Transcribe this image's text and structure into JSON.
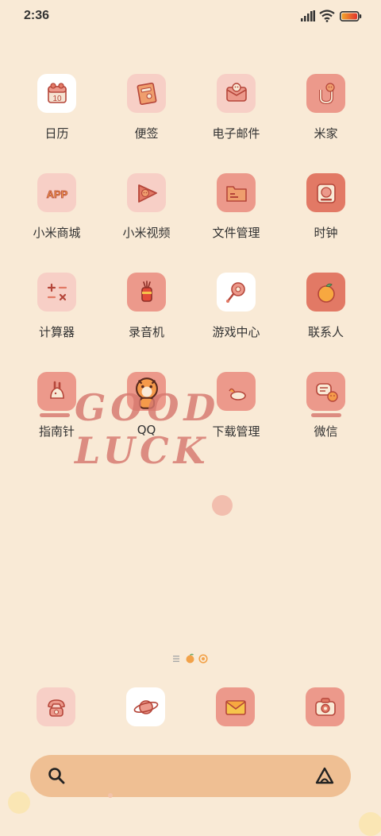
{
  "status_bar": {
    "time": "2:36"
  },
  "apps": [
    {
      "label": "日历",
      "icon": "calendar-icon"
    },
    {
      "label": "便签",
      "icon": "notes-icon"
    },
    {
      "label": "电子邮件",
      "icon": "email-icon"
    },
    {
      "label": "米家",
      "icon": "mijia-icon"
    },
    {
      "label": "小米商城",
      "icon": "mi-store-icon"
    },
    {
      "label": "小米视频",
      "icon": "video-icon"
    },
    {
      "label": "文件管理",
      "icon": "folder-icon"
    },
    {
      "label": "时钟",
      "icon": "clock-icon"
    },
    {
      "label": "计算器",
      "icon": "calculator-icon"
    },
    {
      "label": "录音机",
      "icon": "recorder-icon"
    },
    {
      "label": "游戏中心",
      "icon": "game-center-icon"
    },
    {
      "label": "联系人",
      "icon": "orange-icon"
    },
    {
      "label": "指南针",
      "icon": "compass-icon"
    },
    {
      "label": "QQ",
      "icon": "tiger-qq-icon"
    },
    {
      "label": "下载管理",
      "icon": "download-icon"
    },
    {
      "label": "微信",
      "icon": "wechat-icon"
    }
  ],
  "overlay": {
    "text": "GOOD LUCK"
  },
  "calendar": {
    "day": "10"
  },
  "mi_store": {
    "text": "APP"
  },
  "dock": [
    {
      "icon": "phone-icon"
    },
    {
      "icon": "browser-planet-icon"
    },
    {
      "icon": "messages-envelope-icon"
    },
    {
      "icon": "camera-icon"
    }
  ],
  "colors": {
    "background": "#f9ead6",
    "tile_pink": "#f7cfc6",
    "tile_coral": "#ec998b",
    "tile_deep": "#e27965",
    "search_bar": "#efbf93",
    "accent_stroke": "#b5463a"
  }
}
